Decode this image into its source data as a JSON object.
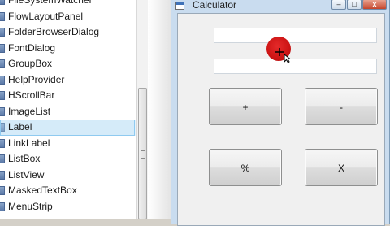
{
  "toolbox": {
    "items": [
      {
        "label": "FileSystemWatcher",
        "selected": false
      },
      {
        "label": "FlowLayoutPanel",
        "selected": false
      },
      {
        "label": "FolderBrowserDialog",
        "selected": false
      },
      {
        "label": "FontDialog",
        "selected": false
      },
      {
        "label": "GroupBox",
        "selected": false
      },
      {
        "label": "HelpProvider",
        "selected": false
      },
      {
        "label": "HScrollBar",
        "selected": false
      },
      {
        "label": "ImageList",
        "selected": false
      },
      {
        "label": "Label",
        "selected": true
      },
      {
        "label": "LinkLabel",
        "selected": false
      },
      {
        "label": "ListBox",
        "selected": false
      },
      {
        "label": "ListView",
        "selected": false
      },
      {
        "label": "MaskedTextBox",
        "selected": false
      },
      {
        "label": "MenuStrip",
        "selected": false
      }
    ]
  },
  "form": {
    "title": "Calculator",
    "caption_buttons": {
      "minimize": "–",
      "maximize": "□",
      "close": "x"
    },
    "textbox1_value": "",
    "textbox2_value": "",
    "buttons": {
      "plus": "+",
      "minus": "-",
      "percent": "%",
      "multiply": "X"
    }
  },
  "colors": {
    "selection_highlight": "#e6f3fb",
    "click_indicator": "#cc1414",
    "snap_guide": "#5a7fd0"
  }
}
